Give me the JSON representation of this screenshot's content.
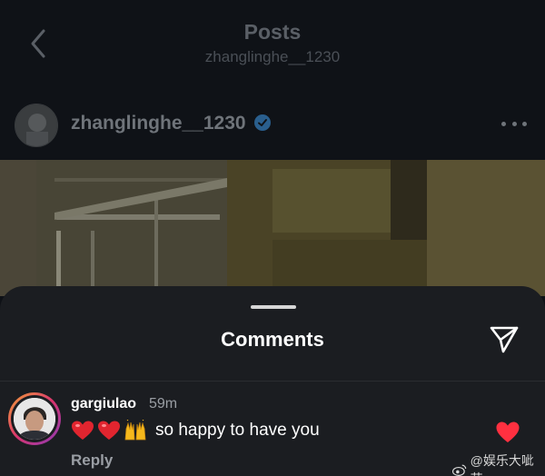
{
  "header": {
    "title": "Posts",
    "subtitle": "zhanglinghe__1230"
  },
  "post": {
    "author": "zhanglinghe__1230",
    "verified": true
  },
  "comments_sheet": {
    "title": "Comments",
    "comments": [
      {
        "username": "gargiulao",
        "time": "59m",
        "emojis": [
          "red-heart",
          "red-heart",
          "raising-hands"
        ],
        "text": "so happy to have you",
        "reply_label": "Reply",
        "liked": true
      }
    ]
  },
  "watermark": {
    "text": "@娱乐大呲花"
  },
  "colors": {
    "background": "#0e1116",
    "sheet": "#1b1d21",
    "like_red": "#ff3040",
    "verified_blue": "#3897f0",
    "muted_text": "#9a9ea4"
  }
}
